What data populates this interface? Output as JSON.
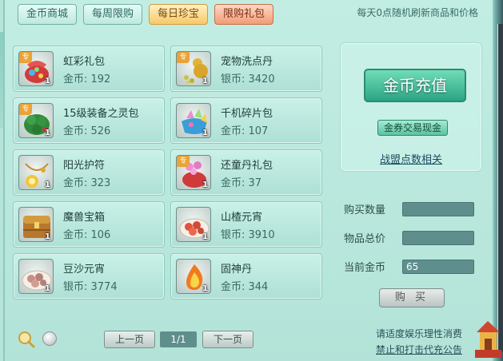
{
  "tabs": [
    {
      "label": "金币商城"
    },
    {
      "label": "每周限购"
    },
    {
      "label": "每日珍宝"
    },
    {
      "label": "限购礼包"
    }
  ],
  "notice": "每天0点随机刷新商品和价格",
  "items": [
    {
      "name": "虹彩礼包",
      "price": "金币: 192",
      "qty": "1",
      "tag": "专",
      "icon": "rainbow-giftbag-icon"
    },
    {
      "name": "宠物洗点丹",
      "price": "银币: 3420",
      "qty": "1",
      "tag": "专",
      "icon": "pet-pill-gourd-icon"
    },
    {
      "name": "15级装备之灵包",
      "price": "金币: 526",
      "qty": "1",
      "tag": "专",
      "icon": "green-spirit-bag-icon"
    },
    {
      "name": "千机碎片包",
      "price": "金币: 107",
      "qty": "1",
      "tag": "",
      "icon": "crystal-shard-bag-icon"
    },
    {
      "name": "阳光护符",
      "price": "金币: 323",
      "qty": "1",
      "tag": "",
      "icon": "sun-amulet-icon"
    },
    {
      "name": "还童丹礼包",
      "price": "金币: 37",
      "qty": "1",
      "tag": "专",
      "icon": "rejuvenation-giftbag-icon"
    },
    {
      "name": "魔兽宝箱",
      "price": "金币: 106",
      "qty": "1",
      "tag": "",
      "icon": "treasure-chest-icon"
    },
    {
      "name": "山楂元宵",
      "price": "银币: 3910",
      "qty": "1",
      "tag": "",
      "icon": "hawthorn-dumplings-icon"
    },
    {
      "name": "豆沙元宵",
      "price": "银币: 3774",
      "qty": "1",
      "tag": "",
      "icon": "redbean-dumplings-icon"
    },
    {
      "name": "固神丹",
      "price": "金币: 344",
      "qty": "1",
      "tag": "",
      "icon": "fire-pill-icon"
    }
  ],
  "recharge": {
    "button": "金币充值",
    "exchange": "金券交易现金",
    "alliance": "战盟点数相关"
  },
  "purchase": {
    "qty_label": "购买数量",
    "qty_value": "",
    "total_label": "物品总价",
    "total_value": "",
    "gold_label": "当前金币",
    "gold_value": "65",
    "buy_button": "购 买"
  },
  "pager": {
    "prev": "上一页",
    "page": "1/1",
    "next": "下一页"
  },
  "footer": {
    "line1": "请适度娱乐理性消费",
    "line2": "禁止和打击代充公告"
  },
  "colors": {
    "accent_gold": "#f7c96a",
    "accent_green": "#2ca584",
    "limited_red": "#f29b76"
  }
}
